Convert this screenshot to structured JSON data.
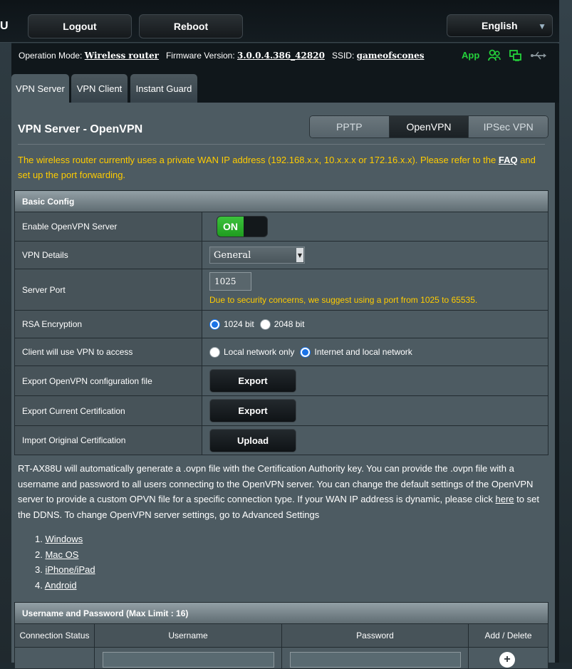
{
  "header": {
    "logo_fragment": "U",
    "logout_label": "Logout",
    "reboot_label": "Reboot",
    "language": "English"
  },
  "info": {
    "op_mode_label": "Operation Mode:",
    "op_mode_value": "Wireless router",
    "firmware_label": "Firmware Version:",
    "firmware_value": "3.0.0.4.386_42820",
    "ssid_label": "SSID:",
    "ssid_value": "gameofscones",
    "app_label": "App",
    "icons": [
      "user-status-icon",
      "network-status-icon",
      "usb-status-icon"
    ]
  },
  "tabs": [
    "VPN Server",
    "VPN Client",
    "Instant Guard"
  ],
  "page": {
    "title": "VPN Server - OpenVPN",
    "protocols": [
      "PPTP",
      "OpenVPN",
      "IPSec VPN"
    ],
    "notice_pre": "The wireless router currently uses a private WAN IP address (192.168.x.x, 10.x.x.x or 172.16.x.x). Please refer to the ",
    "notice_link": "FAQ",
    "notice_post": " and set up the port forwarding."
  },
  "basic_config": {
    "title": "Basic Config",
    "enable_label": "Enable OpenVPN Server",
    "enable_state": "ON",
    "details_label": "VPN Details",
    "details_value": "General",
    "port_label": "Server Port",
    "port_value": "1025",
    "port_hint": "Due to security concerns, we suggest using a port from 1025 to 65535.",
    "rsa_label": "RSA Encryption",
    "rsa_opt1": "1024 bit",
    "rsa_opt2": "2048 bit",
    "access_label": "Client will use VPN to access",
    "access_opt1": "Local network only",
    "access_opt2": "Internet and local network",
    "export_cfg_label": "Export OpenVPN configuration file",
    "export_cfg_btn": "Export",
    "export_cert_label": "Export Current Certification",
    "export_cert_btn": "Export",
    "import_cert_label": "Import Original Certification",
    "import_cert_btn": "Upload"
  },
  "description": {
    "text_pre": "RT-AX88U will automatically generate a .ovpn file with the Certification Authority key. You can provide the .ovpn file with a username and password to all users connecting to the OpenVPN server. You can change the default settings of the OpenVPN server to provide a custom OPVN file for a specific connection type. If your WAN IP address is dynamic, please click ",
    "link": "here",
    "text_post": " to set the DDNS. To change OpenVPN server settings, go to Advanced Settings"
  },
  "os_links": [
    "Windows",
    "Mac OS",
    "iPhone/iPad",
    "Android"
  ],
  "user_table": {
    "title": "Username and Password (Max Limit : 16)",
    "columns": [
      "Connection Status",
      "Username",
      "Password",
      "Add / Delete"
    ]
  }
}
